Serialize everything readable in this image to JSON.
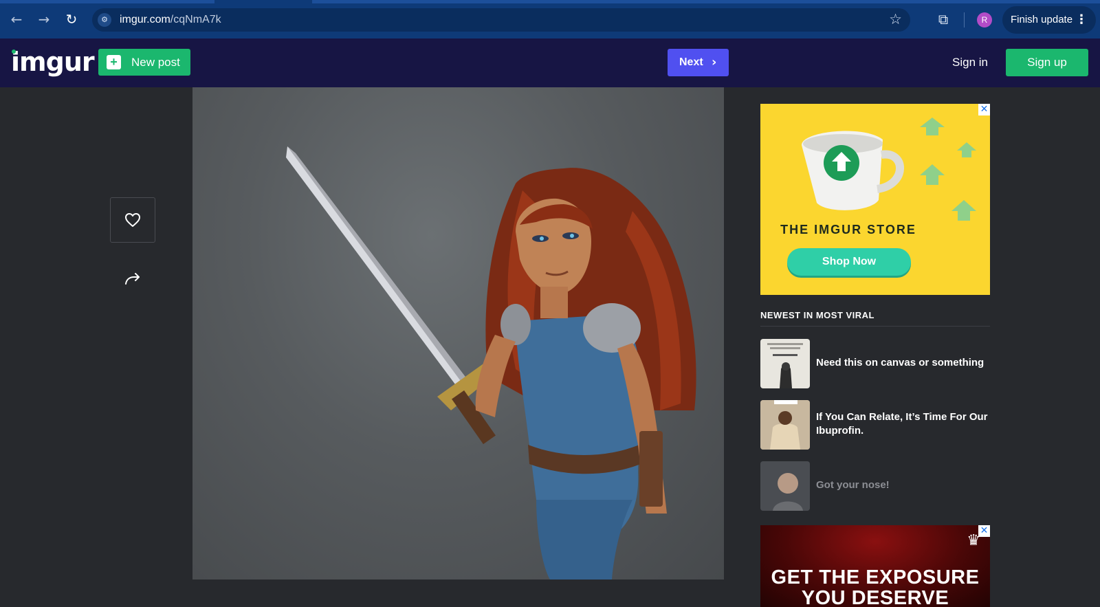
{
  "browser": {
    "url_host": "imgur.com",
    "url_path": "/cqNmA7k",
    "back_icon": "←",
    "forward_icon": "→",
    "reload_icon": "↻",
    "star_icon": "☆",
    "extensions_icon": "⧉",
    "profile_initial": "R",
    "finish_update_label": "Finish update",
    "menu_icon": "⋮"
  },
  "header": {
    "logo": "imgur",
    "new_post_label": "New post",
    "next_label": "Next",
    "next_icon": "›",
    "sign_in_label": "Sign in",
    "sign_up_label": "Sign up"
  },
  "ads": {
    "store": {
      "close": "✕",
      "title": "THE IMGUR STORE",
      "cta": "Shop Now"
    },
    "exposure": {
      "close": "✕",
      "headline_line1": "GET THE EXPOSURE",
      "headline_line2": "YOU DESERVE",
      "crown": "♛"
    }
  },
  "newest": {
    "heading": "NEWEST IN MOST VIRAL",
    "items": [
      {
        "title": "Need this on canvas or something"
      },
      {
        "title": "If You Can Relate, It’s Time For Our Ibuprofin."
      },
      {
        "title": "Got your nose!"
      }
    ]
  },
  "colors": {
    "brand_green": "#1bb76e",
    "next_blue": "#5050f0",
    "header_bg": "#171544",
    "page_bg": "#27292d"
  }
}
